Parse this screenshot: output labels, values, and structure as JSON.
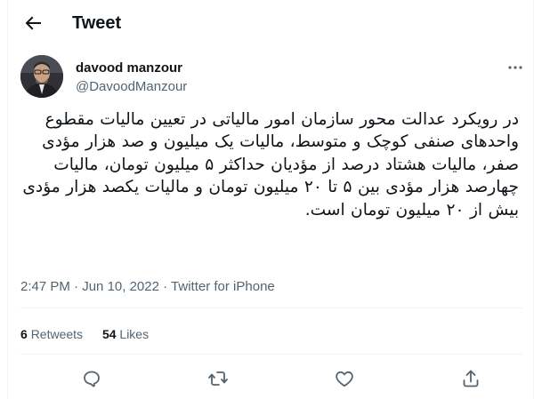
{
  "header": {
    "title": "Tweet",
    "back_icon": "arrow-left-icon"
  },
  "author": {
    "display_name": "davood manzour",
    "handle": "@DavoodManzour",
    "more_icon": "ellipsis-icon"
  },
  "tweet": {
    "text": "در رویکرد عدالت محور سازمان امور مالیاتی در تعیین مالیات مقطوع واحدهای صنفی کوچک و متوسط، مالیات یک میلیون و صد هزار مؤدی صفر، مالیات هشتاد درصد از مؤدیان حداکثر ۵ میلیون تومان، مالیات چهارصد هزار مؤدی بین ۵ تا ۲۰ میلیون تومان و مالیات یکصد هزار مؤدی بیش از ۲۰ میلیون تومان است.",
    "time": "2:47 PM",
    "separator": "·",
    "date": "Jun 10, 2022",
    "source": "Twitter for iPhone"
  },
  "stats": {
    "retweets_count": "6",
    "retweets_label": "Retweets",
    "likes_count": "54",
    "likes_label": "Likes"
  },
  "actions": {
    "reply_icon": "reply-icon",
    "retweet_icon": "retweet-icon",
    "like_icon": "heart-icon",
    "share_icon": "share-icon"
  },
  "colors": {
    "text": "#0f1419",
    "secondary": "#536471",
    "border": "#eff3f4"
  }
}
